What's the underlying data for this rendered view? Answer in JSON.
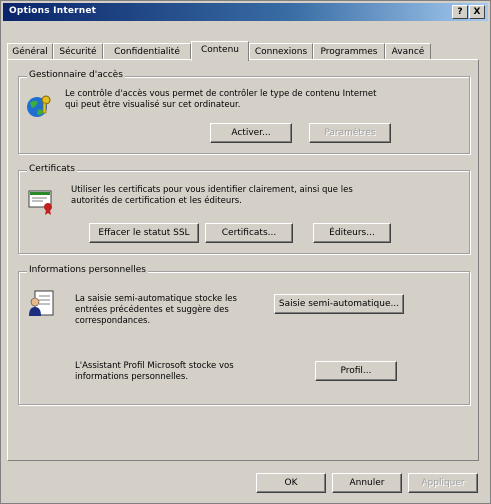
{
  "window": {
    "title": "Options Internet",
    "help_btn": "?",
    "close_btn": "X"
  },
  "tabs": [
    {
      "label": "Général"
    },
    {
      "label": "Sécurité"
    },
    {
      "label": "Confidentialité"
    },
    {
      "label": "Contenu"
    },
    {
      "label": "Connexions"
    },
    {
      "label": "Programmes"
    },
    {
      "label": "Avancé"
    }
  ],
  "access": {
    "legend": "Gestionnaire d'accès",
    "description": "Le contrôle d'accès vous permet de contrôler le type de contenu Internet qui peut être visualisé sur cet ordinateur.",
    "enable_btn": "Activer...",
    "settings_btn": "Paramètres"
  },
  "certificates": {
    "legend": "Certificats",
    "description": "Utiliser les certificats pour vous identifier clairement, ainsi que les autorités de certification et les éditeurs.",
    "clear_ssl_btn": "Effacer le statut SSL",
    "certificates_btn": "Certificats...",
    "publishers_btn": "Éditeurs..."
  },
  "personal": {
    "legend": "Informations personnelles",
    "autocomplete_text": "La saisie semi-automatique stocke les entrées précédentes et suggère des correspondances.",
    "autocomplete_btn": "Saisie semi-automatique...",
    "profile_text": "L'Assistant Profil Microsoft stocke vos informations personnelles.",
    "profile_btn": "Profil..."
  },
  "footer": {
    "ok_btn": "OK",
    "cancel_btn": "Annuler",
    "apply_btn": "Appliquer"
  },
  "colors": {
    "titlebar": "#0a246a",
    "face": "#d4d0c8"
  }
}
